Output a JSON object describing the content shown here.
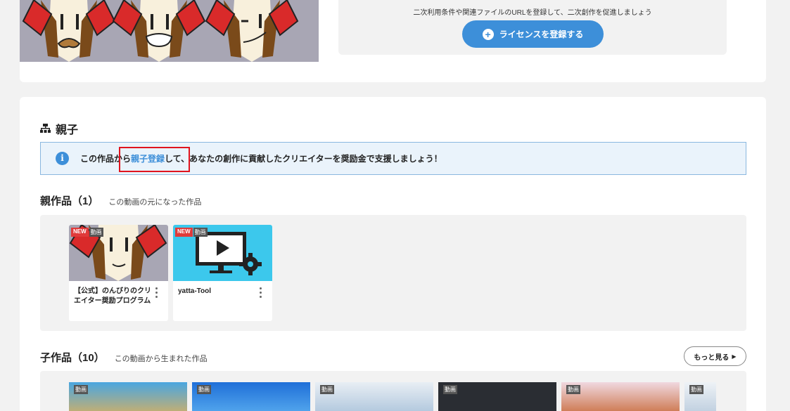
{
  "license": {
    "description": "二次利用条件や関連ファイルのURLを登録して、二次創作を促進しましょう",
    "button_label": "ライセンスを登録する"
  },
  "family": {
    "title": "親子",
    "info_prefix": "この作品から",
    "info_link": "親子登録",
    "info_suffix": "して、あなたの創作に貢献したクリエイターを奨励金で支援しましょう！"
  },
  "parents": {
    "heading": "親作品（1）",
    "description": "この動画の元になった作品",
    "items": [
      {
        "badge_new": "NEW",
        "badge_type": "動画",
        "title": "【公式】のんびりのクリエイター奨励プログラム"
      },
      {
        "badge_new": "NEW",
        "badge_type": "動画",
        "title": "yatta-Tool"
      }
    ]
  },
  "children": {
    "heading": "子作品（10）",
    "description": "この動画から生まれた作品",
    "more_label": "もっと見る",
    "items": [
      {
        "badge_type": "動画"
      },
      {
        "badge_type": "動画"
      },
      {
        "badge_type": "動画"
      },
      {
        "badge_type": "動画"
      },
      {
        "badge_type": "動画"
      },
      {
        "badge_type": "動画"
      }
    ]
  },
  "colors": {
    "accent": "#3d8fd9",
    "highlight": "#e0141e",
    "new_badge": "#e03a3a"
  }
}
